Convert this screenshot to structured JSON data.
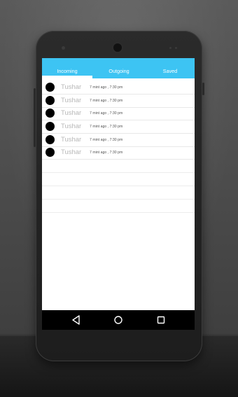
{
  "tabs": [
    {
      "label": "Incoming",
      "active": true
    },
    {
      "label": "Outgoing",
      "active": false
    },
    {
      "label": "Saved",
      "active": false
    }
  ],
  "calls": [
    {
      "name": "Tushar",
      "time": "7 mint ago , 7:30 pm"
    },
    {
      "name": "Tushar",
      "time": "7 mint ago , 7:30 pm"
    },
    {
      "name": "Tushar",
      "time": "7 mint ago , 7:30 pm"
    },
    {
      "name": "Tushar",
      "time": "7 mint ago , 7:30 pm"
    },
    {
      "name": "Tushar",
      "time": "7 mint ago , 7:30 pm"
    },
    {
      "name": "Tushar",
      "time": "7 mint ago , 7:30 pm"
    }
  ],
  "navigation": {
    "buttons": [
      {
        "icon": "back-icon"
      },
      {
        "icon": "home-icon"
      },
      {
        "icon": "recents-icon"
      }
    ]
  },
  "colors": {
    "accent": "#3dc4f3",
    "avatar": "#000000",
    "name_text": "#b8b8b8"
  }
}
